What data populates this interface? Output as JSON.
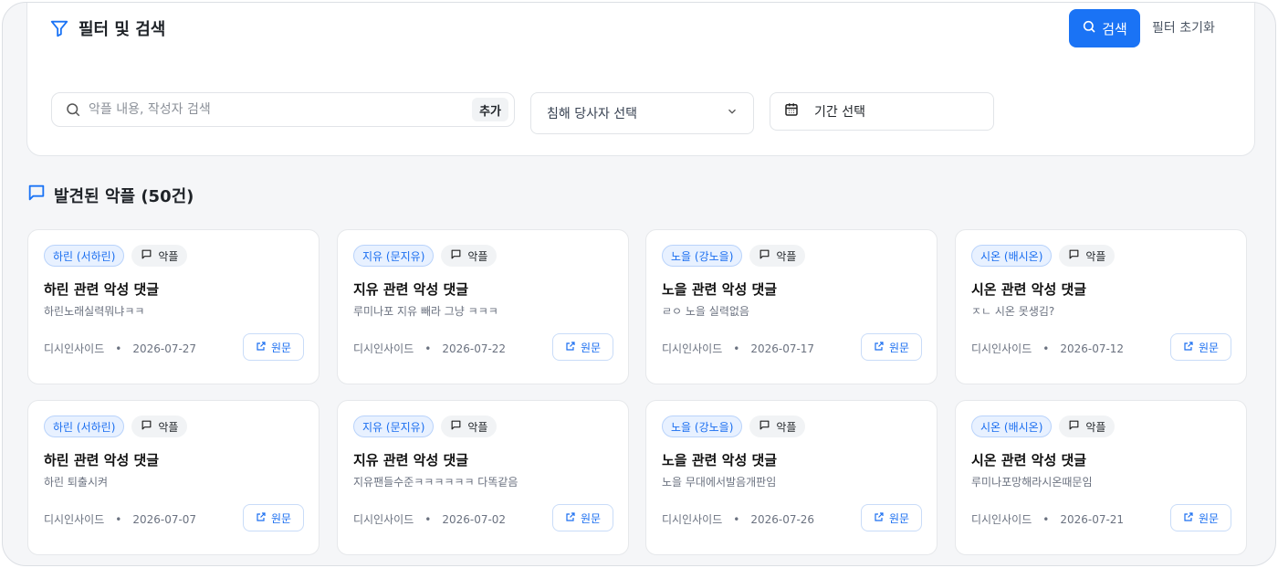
{
  "filter": {
    "title": "필터 및 검색",
    "search_button": "검색",
    "reset_button": "필터 초기화",
    "search_placeholder": "악플 내용, 작성자 검색",
    "add_button": "추가",
    "victim_select": "침해 당사자 선택",
    "date_picker": "기간 선택"
  },
  "results": {
    "heading": "발견된 악플 (50건)"
  },
  "accent_color": "#1a73f5",
  "cards": [
    {
      "person": "하린 (서하린)",
      "type": "악플",
      "title": "하린 관련 악성 댓글",
      "body": "하린노래실력뭐냐ㅋㅋ",
      "source": "디시인사이드",
      "date": "2026-07-27",
      "button": "원문"
    },
    {
      "person": "지유 (문지유)",
      "type": "악플",
      "title": "지유 관련 악성 댓글",
      "body": "루미나포 지유 빼라 그냥 ㅋㅋㅋ",
      "source": "디시인사이드",
      "date": "2026-07-22",
      "button": "원문"
    },
    {
      "person": "노을 (강노을)",
      "type": "악플",
      "title": "노을 관련 악성 댓글",
      "body": "ㄹㅇ 노을 실력없음",
      "source": "디시인사이드",
      "date": "2026-07-17",
      "button": "원문"
    },
    {
      "person": "시온 (배시온)",
      "type": "악플",
      "title": "시온 관련 악성 댓글",
      "body": "ㅈㄴ 시온 못생김?",
      "source": "디시인사이드",
      "date": "2026-07-12",
      "button": "원문"
    },
    {
      "person": "하린 (서하린)",
      "type": "악플",
      "title": "하린 관련 악성 댓글",
      "body": "하린 퇴출시켜",
      "source": "디시인사이드",
      "date": "2026-07-07",
      "button": "원문"
    },
    {
      "person": "지유 (문지유)",
      "type": "악플",
      "title": "지유 관련 악성 댓글",
      "body": "지유팬들수준ㅋㅋㅋㅋㅋㅋ 다똑같음",
      "source": "디시인사이드",
      "date": "2026-07-02",
      "button": "원문"
    },
    {
      "person": "노을 (강노을)",
      "type": "악플",
      "title": "노을 관련 악성 댓글",
      "body": "노을 무대에서발음개판임",
      "source": "디시인사이드",
      "date": "2026-07-26",
      "button": "원문"
    },
    {
      "person": "시온 (배시온)",
      "type": "악플",
      "title": "시온 관련 악성 댓글",
      "body": "루미나포망해라시온때문임",
      "source": "디시인사이드",
      "date": "2026-07-21",
      "button": "원문"
    }
  ]
}
